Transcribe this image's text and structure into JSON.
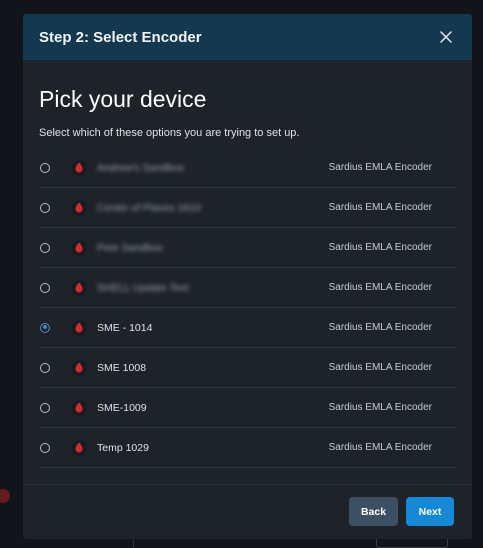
{
  "modal": {
    "title": "Step 2: Select Encoder",
    "heading": "Pick your device",
    "subtitle": "Select which of these options you are trying to set up."
  },
  "devices": [
    {
      "name": "Andrew's Sandbox",
      "type": "Sardius EMLA Encoder",
      "selected": false,
      "blurred": true
    },
    {
      "name": "Center of Places 1810",
      "type": "Sardius EMLA Encoder",
      "selected": false,
      "blurred": true
    },
    {
      "name": "Pete Sandbox",
      "type": "Sardius EMLA Encoder",
      "selected": false,
      "blurred": true
    },
    {
      "name": "SHELL Update Test",
      "type": "Sardius EMLA Encoder",
      "selected": false,
      "blurred": true
    },
    {
      "name": "SME - 1014",
      "type": "Sardius EMLA Encoder",
      "selected": true,
      "blurred": false
    },
    {
      "name": "SME 1008",
      "type": "Sardius EMLA Encoder",
      "selected": false,
      "blurred": false
    },
    {
      "name": "SME-1009",
      "type": "Sardius EMLA Encoder",
      "selected": false,
      "blurred": false
    },
    {
      "name": "Temp 1029",
      "type": "Sardius EMLA Encoder",
      "selected": false,
      "blurred": false
    }
  ],
  "footer": {
    "back_label": "Back",
    "next_label": "Next"
  },
  "colors": {
    "header_bg": "#13384f",
    "modal_bg": "#1e2329",
    "primary_button": "#1689d6",
    "secondary_button": "#3d4f62",
    "device_icon_accent": "#d42a2a"
  },
  "icons": {
    "close": "close-icon",
    "device": "device-shield-icon"
  }
}
